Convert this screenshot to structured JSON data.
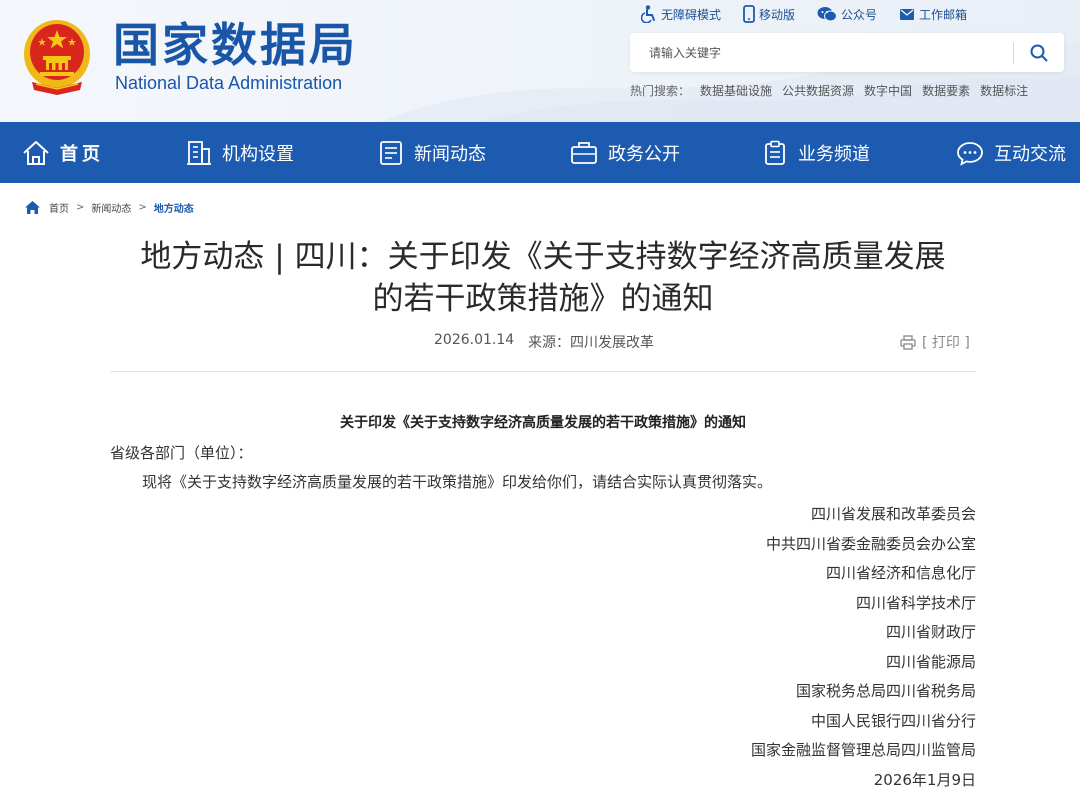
{
  "header": {
    "logo_cn": "国家数据局",
    "logo_en": "National Data Administration",
    "top_links": [
      {
        "icon": "accessibility-icon",
        "label": "无障碍模式"
      },
      {
        "icon": "mobile-icon",
        "label": "移动版"
      },
      {
        "icon": "wechat-icon",
        "label": "公众号"
      },
      {
        "icon": "mail-icon",
        "label": "工作邮箱"
      }
    ],
    "search": {
      "placeholder": "请输入关键字"
    },
    "hot_search": {
      "label": "热门搜索：",
      "keywords": [
        "数据基础设施",
        "公共数据资源",
        "数字中国",
        "数据要素",
        "数据标注"
      ]
    }
  },
  "nav": {
    "items": [
      {
        "icon": "home-icon",
        "label": "首页"
      },
      {
        "icon": "building-icon",
        "label": "机构设置"
      },
      {
        "icon": "news-icon",
        "label": "新闻动态"
      },
      {
        "icon": "briefcase-icon",
        "label": "政务公开"
      },
      {
        "icon": "clipboard-icon",
        "label": "业务频道"
      },
      {
        "icon": "chat-icon",
        "label": "互动交流"
      }
    ]
  },
  "breadcrumb": {
    "items": [
      "首页",
      "新闻动态",
      "地方动态"
    ],
    "separator": ">"
  },
  "article": {
    "title_line1": "地方动态 | 四川：关于印发《关于支持数字经济高质量发展",
    "title_line2": "的若干政策措施》的通知",
    "date": "2026.01.14",
    "source": "来源：四川发展改革",
    "print_label": "[ 打印 ]",
    "body_title": "关于印发《关于支持数字经济高质量发展的若干政策措施》的通知",
    "salutation": "省级各部门（单位）：",
    "paragraph": "现将《关于支持数字经济高质量发展的若干政策措施》印发给你们，请结合实际认真贯彻落实。",
    "signatures": [
      "四川省发展和改革委员会",
      "中共四川省委金融委员会办公室",
      "四川省经济和信息化厅",
      "四川省科学技术厅",
      "四川省财政厅",
      "四川省能源局",
      "国家税务总局四川省税务局",
      "中国人民银行四川省分行",
      "国家金融监督管理总局四川监管局",
      "2026年1月9日"
    ]
  },
  "colors": {
    "brand_blue": "#1d5bb0",
    "logo_blue": "#1a56a8",
    "emblem_red": "#d9261c",
    "emblem_gold": "#f5c518"
  }
}
